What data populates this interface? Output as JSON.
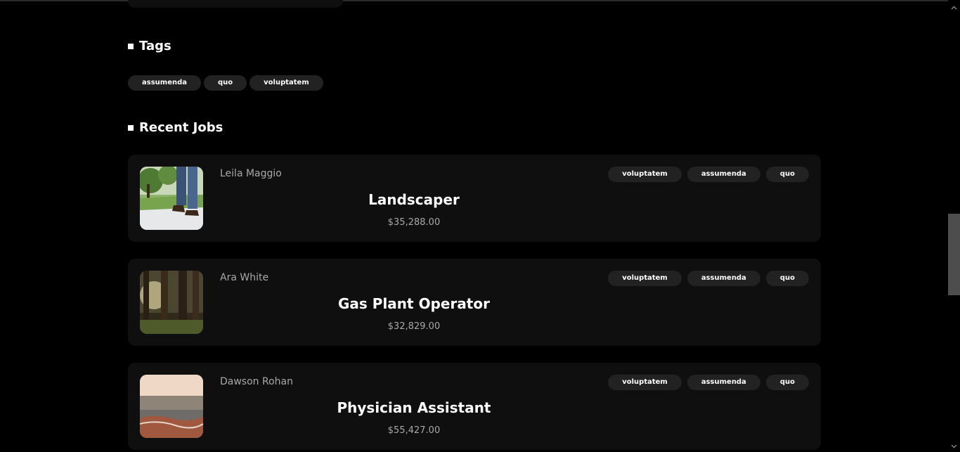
{
  "tags_section": {
    "heading": "Tags",
    "tags": [
      "assumenda",
      "quo",
      "voluptatem"
    ]
  },
  "jobs_section": {
    "heading": "Recent Jobs",
    "jobs": [
      {
        "company": "Leila Maggio",
        "title": "Landscaper",
        "salary": "$35,288.00",
        "tags": [
          "voluptatem",
          "assumenda",
          "quo"
        ],
        "thumb": "walking-person-park-photo"
      },
      {
        "company": "Ara White",
        "title": "Gas Plant Operator",
        "salary": "$32,829.00",
        "tags": [
          "voluptatem",
          "assumenda",
          "quo"
        ],
        "thumb": "forest-sunlight-photo"
      },
      {
        "company": "Dawson Rohan",
        "title": "Physician Assistant",
        "salary": "$55,427.00",
        "tags": [
          "voluptatem",
          "assumenda",
          "quo"
        ],
        "thumb": "beach-waves-photo"
      }
    ]
  },
  "scrollbar": {
    "up_icon": "chevron-up-icon",
    "down_icon": "chevron-down-icon"
  }
}
